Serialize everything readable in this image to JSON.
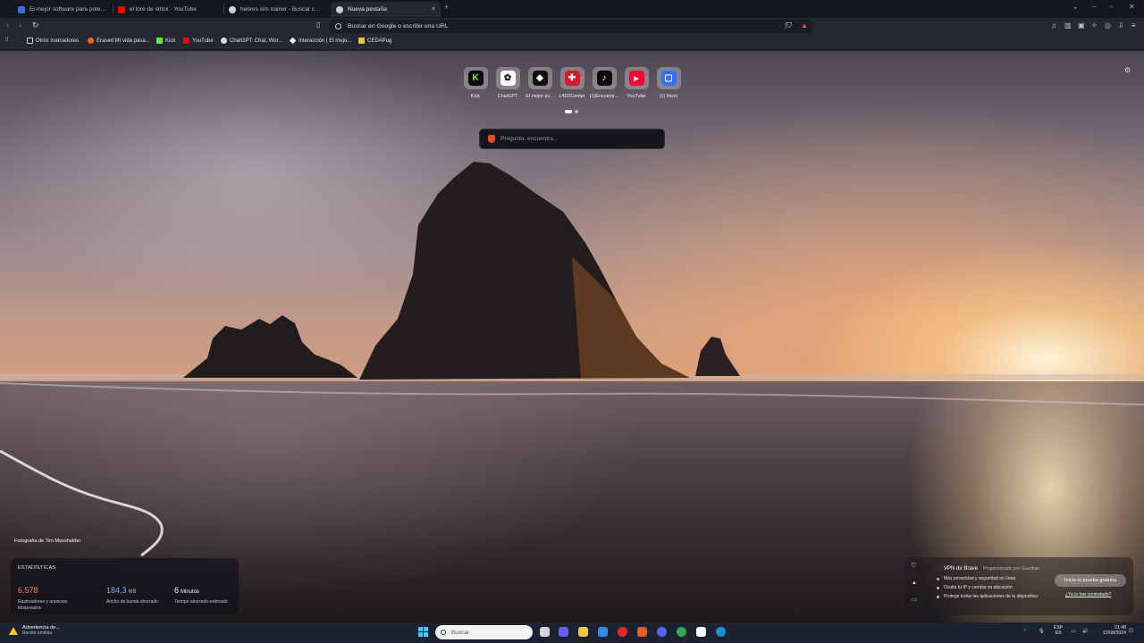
{
  "tabs": [
    {
      "title": "El mejor software para potenciar tu ...",
      "color": "#3a6fd9"
    },
    {
      "title": "el lore de strick - YouTube",
      "color": "#ff0000"
    },
    {
      "title": "hebres sim trainer - Buscar con Goo...",
      "color": "#cfd3da"
    },
    {
      "title": "Nueva pestaña",
      "color": "#c9cdd4",
      "active": true,
      "close": "×"
    }
  ],
  "new_tab": "+",
  "address_bar": {
    "placeholder": "Buscar en Google o escribir una URL"
  },
  "bookmarks": [
    {
      "label": "Otros marcadores",
      "icon": "folder-icon",
      "color": "#cfd3da"
    },
    {
      "label": "Erased MI vida pasa...",
      "icon": "erased-icon",
      "color": "#e56a1f"
    },
    {
      "label": "Kick",
      "icon": "kick-icon",
      "color": "#53fc18"
    },
    {
      "label": "YouTube",
      "icon": "youtube-icon",
      "color": "#ff0000"
    },
    {
      "label": "ChatGPT: Chat, Wor...",
      "icon": "chatgpt-icon",
      "color": "#d9d9d9"
    },
    {
      "label": "Interacción | El mejo...",
      "icon": "diamond-icon",
      "color": "#ffffff"
    },
    {
      "label": "CEDAPug",
      "icon": "cedapug-icon",
      "color": "#f4c22b"
    }
  ],
  "shortcuts": [
    {
      "label": "Kick",
      "glyph": "K",
      "bg": "#0b0b0b",
      "fg": "#53fc18"
    },
    {
      "label": "ChatGPT",
      "glyph": "✿",
      "bg": "#ffffff",
      "fg": "#111111"
    },
    {
      "label": "El mejor so...",
      "glyph": "◆",
      "bg": "#111111",
      "fg": "#ffffff"
    },
    {
      "label": "L4D2Center",
      "glyph": "✚",
      "bg": "#d51b2b",
      "fg": "#ffffff"
    },
    {
      "label": "(1)Encuentr...",
      "glyph": "♪",
      "bg": "#0b0b0b",
      "fg": "#ffffff"
    },
    {
      "label": "YouTube",
      "glyph": "▶",
      "bg": "#ff0033",
      "fg": "#ffffff"
    },
    {
      "label": "(1) Inicio",
      "glyph": "▢",
      "bg": "#3b6df2",
      "fg": "#ffffff"
    }
  ],
  "search": {
    "placeholder": "Pregunta, encuentra..."
  },
  "photo_credit": "Fotografía de Tim Mossholder",
  "stats": {
    "heading": "ESTADÍSTICAS",
    "items": [
      {
        "value": "6.578",
        "unit": "",
        "desc": "Rastreadores y anuncios bloqueados",
        "color": "#ff7a5c"
      },
      {
        "value": "184,3",
        "unit": "MB",
        "desc": "Ancho de banda ahorrado",
        "color": "#8aa6ff"
      },
      {
        "value": "6",
        "unit": "Minutos",
        "desc": "Tiempo ahorrado estimado",
        "color": "#ffffff"
      }
    ]
  },
  "vpn": {
    "title": "VPN de Brave",
    "powered": "Proporcionado por  Guardian",
    "features": [
      "Más privacidad y seguridad en línea",
      "Oculta tu IP y cambia su ubicación",
      "Protege todas las aplicaciones de tu dispositivo"
    ],
    "cta": "Inicia la prueba gratuita",
    "link": "¿Ya lo has contratado?"
  },
  "taskbar": {
    "warning_title": "Advertencia de...",
    "warning_sub": "Recién emitida",
    "search_placeholder": "Buscar",
    "apps": [
      {
        "name": "task-view",
        "color": "#d7d7d7"
      },
      {
        "name": "copilot",
        "color": "#6b5cf0"
      },
      {
        "name": "file-explorer",
        "color": "#f4c542"
      },
      {
        "name": "store",
        "color": "#2f8bea"
      },
      {
        "name": "app-red",
        "color": "#e8232b"
      },
      {
        "name": "brave",
        "color": "#f05a24"
      },
      {
        "name": "discord",
        "color": "#5865f2"
      },
      {
        "name": "chrome",
        "color": "#34a853"
      },
      {
        "name": "capcut",
        "color": "#ffffff"
      },
      {
        "name": "steam",
        "color": "#1b8dd0"
      }
    ],
    "lang": "ESP",
    "lang_sub": "ES",
    "time": "21:48",
    "date": "22/08/2024"
  }
}
